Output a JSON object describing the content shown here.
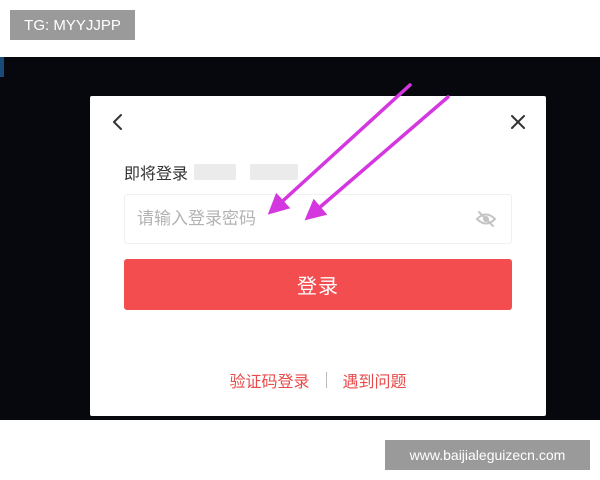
{
  "watermarks": {
    "top": "TG: MYYJJPP",
    "bottom": "www.baijialeguizecn.com"
  },
  "dialog": {
    "prompt": "即将登录",
    "password_placeholder": "请输入登录密码",
    "login_button": "登录",
    "sms_login_link": "验证码登录",
    "help_link": "遇到问题"
  },
  "icons": {
    "back": "chevron-left-icon",
    "close": "close-icon",
    "visibility": "eye-off-icon"
  },
  "colors": {
    "primary": "#f34d50",
    "link": "#e94b4b",
    "annotation_arrow": "#d437e0",
    "backdrop": "#07080d"
  }
}
